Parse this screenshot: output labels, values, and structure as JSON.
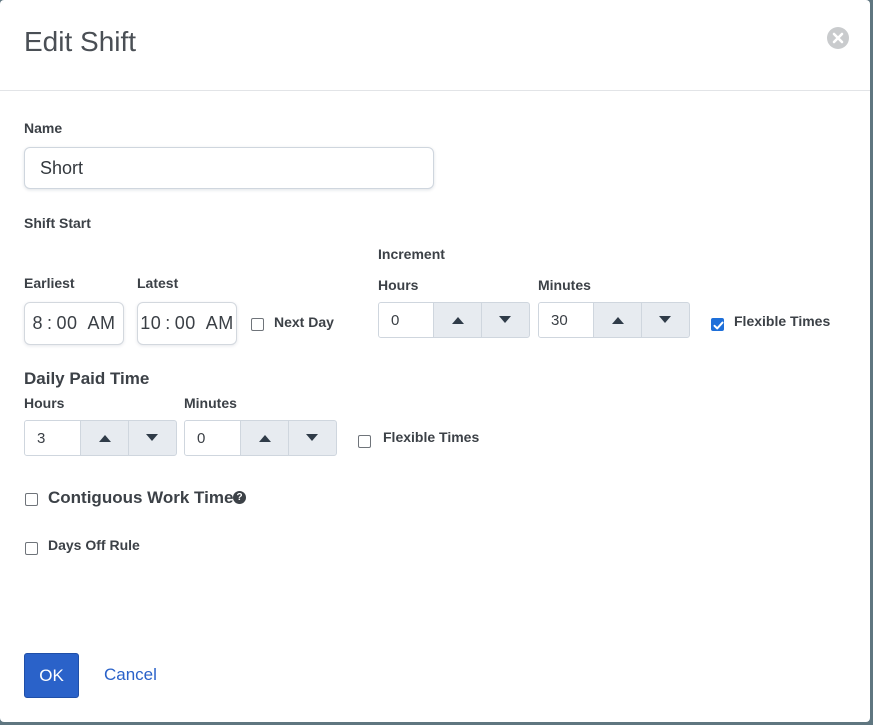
{
  "dialog": {
    "title": "Edit Shift"
  },
  "name": {
    "label": "Name",
    "value": "Short"
  },
  "shift_start": {
    "label": "Shift Start",
    "earliest": {
      "label": "Earliest",
      "hour": "8",
      "minute": "00",
      "ampm": "AM"
    },
    "latest": {
      "label": "Latest",
      "hour": "10",
      "minute": "00",
      "ampm": "AM"
    },
    "next_day": {
      "label": "Next Day",
      "checked": false
    },
    "increment": {
      "label": "Increment",
      "hours": {
        "label": "Hours",
        "value": "0"
      },
      "minutes": {
        "label": "Minutes",
        "value": "30"
      }
    },
    "flexible": {
      "label": "Flexible Times",
      "checked": true
    }
  },
  "daily_paid_time": {
    "label": "Daily Paid Time",
    "hours": {
      "label": "Hours",
      "value": "3"
    },
    "minutes": {
      "label": "Minutes",
      "value": "0"
    },
    "flexible": {
      "label": "Flexible Times",
      "checked": false
    }
  },
  "contiguous": {
    "label": "Contiguous Work Time",
    "checked": false,
    "help_icon": "question-circle-icon"
  },
  "days_off": {
    "label": "Days Off Rule",
    "checked": false
  },
  "actions": {
    "ok": "OK",
    "cancel": "Cancel"
  },
  "colors": {
    "primary": "#2a62c9",
    "checkbox_checked": "#1e6fd9",
    "overlay": "#5f7680"
  }
}
